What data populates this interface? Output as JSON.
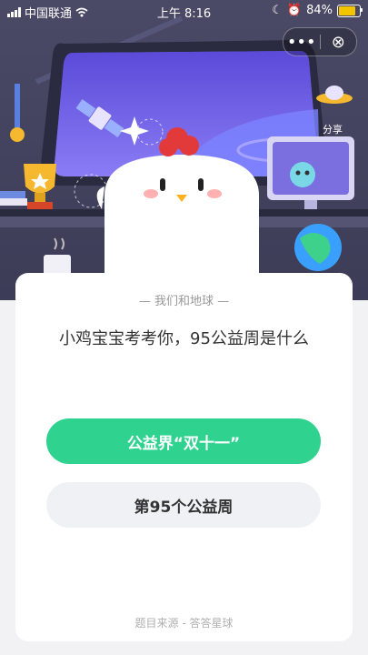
{
  "status_bar": {
    "carrier": "中国联通",
    "time": "上午 8:16",
    "battery_percent": "84%",
    "battery_level": 0.84
  },
  "capsule": {
    "more_icon": "more-dots-icon",
    "close_icon": "close-circle-icon"
  },
  "share": {
    "label": "分享"
  },
  "quiz": {
    "category": "我们和地球",
    "question": "小鸡宝宝考考你，95公益周是什么",
    "options": [
      "公益界“双十一”",
      "第95个公益周"
    ],
    "source": "题目来源 - 答答星球"
  },
  "colors": {
    "accent": "#2fd28f",
    "option_bg": "#f0f1f5",
    "scene_bg": "#3f3f5a"
  }
}
